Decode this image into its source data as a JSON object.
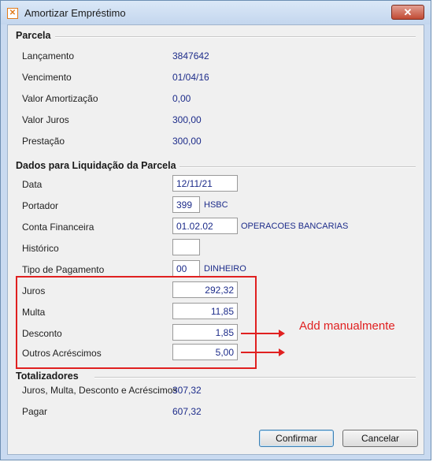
{
  "window": {
    "title": "Amortizar Empréstimo"
  },
  "parcela": {
    "title": "Parcela",
    "rows": [
      {
        "label": "Lançamento",
        "value": "3847642"
      },
      {
        "label": "Vencimento",
        "value": "01/04/16"
      },
      {
        "label": "Valor Amortização",
        "value": "0,00"
      },
      {
        "label": "Valor Juros",
        "value": "300,00"
      },
      {
        "label": "Prestação",
        "value": "300,00"
      }
    ]
  },
  "liquidacao": {
    "title": "Dados para Liquidação da Parcela",
    "data": {
      "label": "Data",
      "value": "12/11/21"
    },
    "portador": {
      "label": "Portador",
      "code": "399",
      "name": "HSBC"
    },
    "conta": {
      "label": "Conta Financeira",
      "code": "01.02.02",
      "name": "OPERACOES BANCARIAS"
    },
    "historico": {
      "label": "Histórico",
      "value": ""
    },
    "tipo": {
      "label": "Tipo de Pagamento",
      "code": "00",
      "name": "DINHEIRO"
    },
    "juros": {
      "label": "Juros",
      "value": "292,32"
    },
    "multa": {
      "label": "Multa",
      "value": "11,85"
    },
    "desconto": {
      "label": "Desconto",
      "value": "1,85"
    },
    "outros": {
      "label": "Outros Acréscimos",
      "value": "5,00"
    }
  },
  "annotation": "Add manualmente",
  "totalizadores": {
    "title": "Totalizadores",
    "rows": [
      {
        "label": "Juros, Multa, Desconto e Acréscimos",
        "value": "307,32"
      },
      {
        "label": "Pagar",
        "value": "607,32"
      }
    ]
  },
  "buttons": {
    "confirm": "Confirmar",
    "cancel": "Cancelar"
  },
  "colors": {
    "highlight": "#e02020",
    "value_text": "#1d2c8a",
    "title_bar": "#c3d6ee"
  }
}
